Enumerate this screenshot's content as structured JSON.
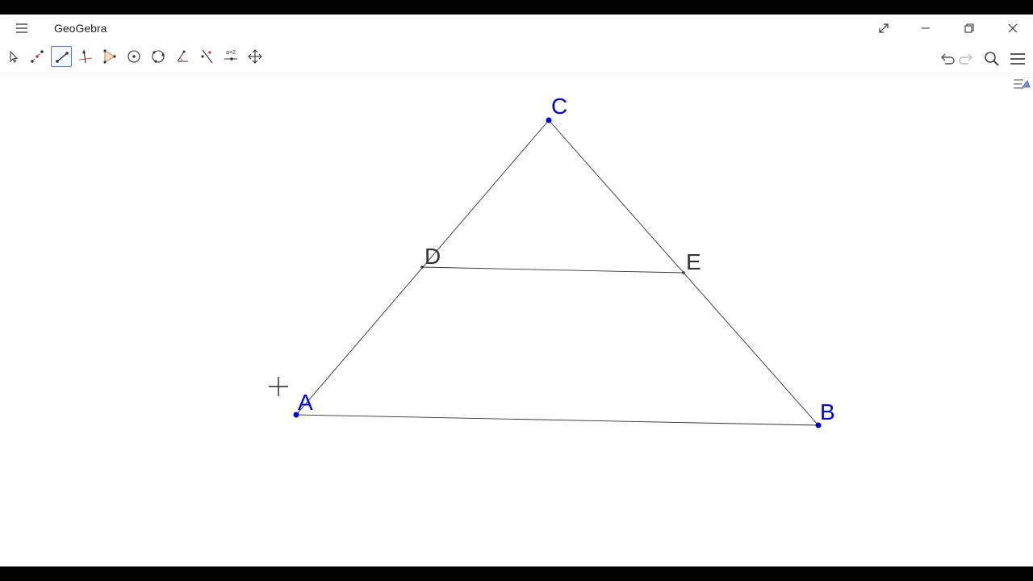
{
  "window": {
    "title": "GeoGebra",
    "controls": [
      "fullscreen",
      "minimize",
      "restore",
      "close"
    ]
  },
  "toolbar": {
    "tools": [
      {
        "name": "move-tool",
        "icon": "arrow-cursor-icon"
      },
      {
        "name": "point-tool",
        "icon": "point-icon"
      },
      {
        "name": "segment-tool",
        "icon": "segment-icon",
        "selected": true
      },
      {
        "name": "perpendicular-line-tool",
        "icon": "perpendicular-icon"
      },
      {
        "name": "polygon-tool",
        "icon": "polygon-icon"
      },
      {
        "name": "circle-center-point-tool",
        "icon": "circle-icon"
      },
      {
        "name": "circle-three-points-tool",
        "icon": "circle-3pts-icon"
      },
      {
        "name": "angle-tool",
        "icon": "angle-icon"
      },
      {
        "name": "reflect-tool",
        "icon": "reflect-icon"
      },
      {
        "name": "slider-tool",
        "icon": "slider-icon",
        "label": "a=2"
      },
      {
        "name": "move-graphics-view-tool",
        "icon": "move-view-icon"
      }
    ],
    "right": [
      "undo-icon",
      "redo-icon",
      "search-icon",
      "menu-icon"
    ]
  },
  "construction": {
    "points": [
      {
        "label": "A",
        "color": "#0000cc"
      },
      {
        "label": "B",
        "color": "#0000cc"
      },
      {
        "label": "C",
        "color": "#0000cc"
      },
      {
        "label": "D",
        "color": "#333333"
      },
      {
        "label": "E",
        "color": "#333333"
      }
    ],
    "segments": [
      "AB",
      "BC",
      "CA",
      "DE"
    ]
  },
  "colors": {
    "free_point": "#0000cc",
    "dependent_point": "#333333",
    "segment": "#333333",
    "selected_tool_border": "#5b7bd0"
  }
}
